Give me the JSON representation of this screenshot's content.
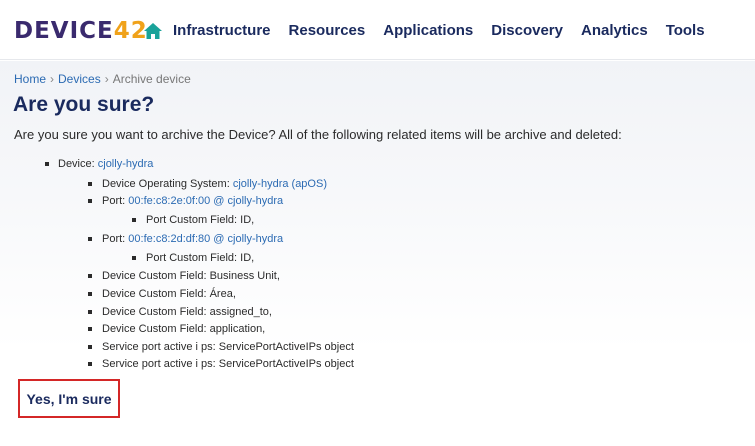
{
  "header": {
    "logo_main": "DEVICE",
    "logo_accent": "42",
    "nav": [
      "Infrastructure",
      "Resources",
      "Applications",
      "Discovery",
      "Analytics",
      "Tools"
    ]
  },
  "breadcrumb": {
    "home": "Home",
    "devices": "Devices",
    "current": "Archive device",
    "separator": "›"
  },
  "page": {
    "title": "Are you sure?",
    "intro": "Are you sure you want to archive the Device? All of the following related items will be archive and deleted:"
  },
  "items": {
    "device_label": "Device: ",
    "device_link": "cjolly-hydra",
    "os_label": "Device Operating System: ",
    "os_link": "cjolly-hydra (apOS)",
    "port1_label": "Port: ",
    "port1_link": "00:fe:c8:2e:0f:00 @ cjolly-hydra",
    "port1_cf": "Port Custom Field: ID,",
    "port2_label": "Port: ",
    "port2_link": "00:fe:c8:2d:df:80 @ cjolly-hydra",
    "port2_cf": "Port Custom Field: ID,",
    "cf1": "Device Custom Field: Business Unit,",
    "cf2": "Device Custom Field: Área,",
    "cf3": "Device Custom Field: assigned_to,",
    "cf4": "Device Custom Field: application,",
    "sp1": "Service port active i ps: ServicePortActiveIPs object",
    "sp2": "Service port active i ps: ServicePortActiveIPs object"
  },
  "actions": {
    "confirm_label": "Yes, I'm sure"
  }
}
